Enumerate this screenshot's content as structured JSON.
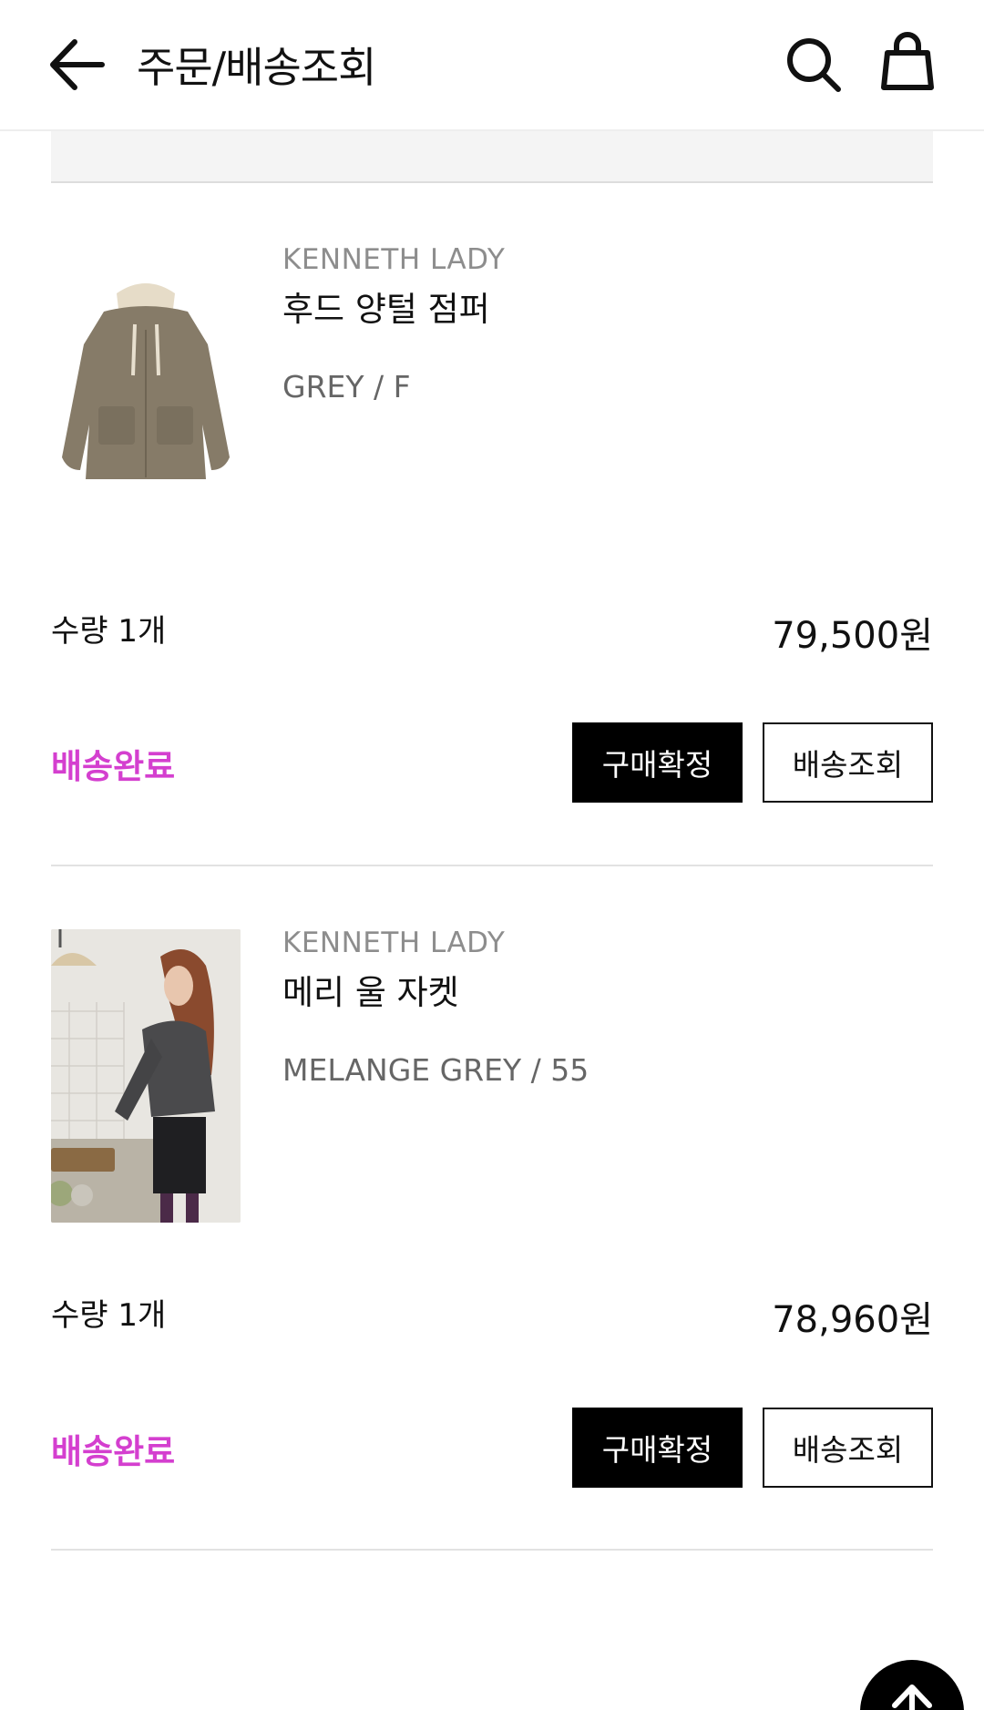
{
  "header": {
    "title": "주문/배송조회",
    "back_icon": "arrow-left-icon",
    "search_icon": "search-icon",
    "cart_icon": "shopping-bag-icon"
  },
  "orders": [
    {
      "brand": "KENNETH LADY",
      "name": "후드 양털 점퍼",
      "option": "GREY / F",
      "quantity": "수량 1개",
      "price": "79,500원",
      "status": "배송완료",
      "confirm_label": "구매확정",
      "track_label": "배송조회"
    },
    {
      "brand": "KENNETH LADY",
      "name": "메리 울 자켓",
      "option": "MELANGE GREY / 55",
      "quantity": "수량 1개",
      "price": "78,960원",
      "status": "배송완료",
      "confirm_label": "구매확정",
      "track_label": "배송조회"
    }
  ],
  "colors": {
    "status": "#d43fcf",
    "confirm_bg": "#000000",
    "brand_text": "#8d8d8d"
  },
  "scroll_top_icon": "arrow-up-icon"
}
